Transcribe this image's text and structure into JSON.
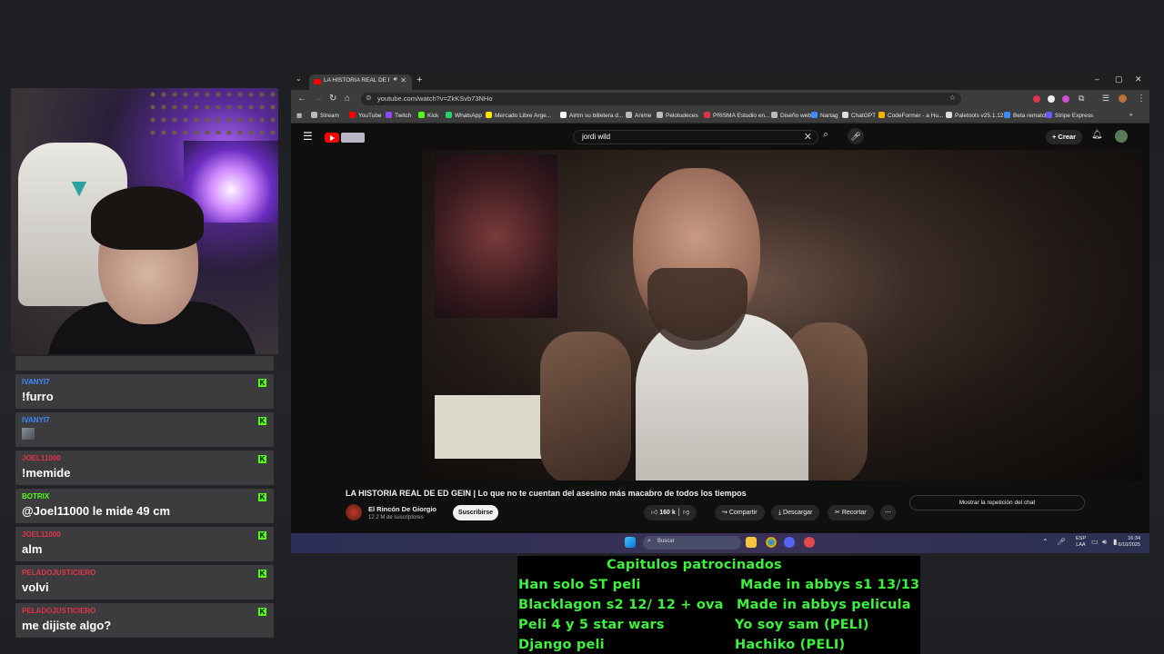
{
  "chat": {
    "messages": [
      {
        "user": "IVANYI7",
        "text": "!furro",
        "user_color": "#3d8bff",
        "emote": false
      },
      {
        "user": "IVANYI7",
        "text": "",
        "user_color": "#3d8bff",
        "emote": true
      },
      {
        "user": "JOEL11000",
        "text": "!memide",
        "user_color": "#e0344a",
        "emote": false
      },
      {
        "user": "BOTRIX",
        "text": "@Joel11000 le mide 49 cm",
        "user_color": "#53fc18",
        "emote": false
      },
      {
        "user": "JOEL11000",
        "text": "alm",
        "user_color": "#e0344a",
        "emote": false
      },
      {
        "user": "PELADOJUSTICIERO",
        "text": "volvi",
        "user_color": "#e0344a",
        "emote": false
      },
      {
        "user": "PELADOJUSTICIERO",
        "text": "me dijiste algo?",
        "user_color": "#e0344a",
        "emote": false
      }
    ]
  },
  "browser": {
    "tab_title": "LA HISTORIA REAL DE ED GEIN",
    "url": "youtube.com/watch?v=ZkKSvb73NHo",
    "bookmarks": [
      {
        "label": "Stream",
        "color": "#bbbbbb"
      },
      {
        "label": "YouTube",
        "color": "#ff0000"
      },
      {
        "label": "Twitch",
        "color": "#9146ff"
      },
      {
        "label": "Kick",
        "color": "#53fc18"
      },
      {
        "label": "WhatsApp",
        "color": "#25d366"
      },
      {
        "label": "Mercado Libre Arge...",
        "color": "#ffe600"
      },
      {
        "label": "Airtm su billetera d...",
        "color": "#ffffff"
      },
      {
        "label": "Anime",
        "color": "#bbbbbb"
      },
      {
        "label": "Pelotudeces",
        "color": "#bbbbbb"
      },
      {
        "label": "PRISMA Estudio en...",
        "color": "#e0344a"
      },
      {
        "label": "Diseño web",
        "color": "#bbbbbb"
      },
      {
        "label": "Nartag",
        "color": "#3d8bff"
      },
      {
        "label": "ChatGPT",
        "color": "#dddddd"
      },
      {
        "label": "CodeFormer - a Hu...",
        "color": "#f5b400"
      },
      {
        "label": "Paletools v25.1.12",
        "color": "#dddddd"
      },
      {
        "label": "Beta rematch",
        "color": "#3d8bff"
      },
      {
        "label": "Stripe Express",
        "color": "#635bff"
      }
    ]
  },
  "youtube": {
    "search_query": "jordi wild",
    "create_label": "Crear",
    "video_title": "LA HISTORIA REAL DE ED GEIN | Lo que no te cuentan del asesino más macabro de todos los tiempos",
    "channel_name": "El Rincón De Giorgio",
    "subscribers": "12.2 M de suscriptores",
    "subscribe_label": "Suscribirse",
    "likes": "160 k",
    "share_label": "Compartir",
    "download_label": "Descargar",
    "clip_label": "Recortar",
    "chat_replay_label": "Mostrar la repetición del chat"
  },
  "taskbar": {
    "search_placeholder": "Buscar",
    "lang_top": "ESP",
    "lang_bottom": "LAA",
    "time": "16:34",
    "date": "6/10/2025"
  },
  "overlay": {
    "title": "Capitulos patrocinados",
    "left": [
      "Han solo ST peli",
      "Blacklagon s2 12/ 12 + ova",
      "Peli 4  y 5 star wars",
      "Django peli"
    ],
    "right": [
      "Made in abbys s1 13/13",
      "Made in abbys pelicula",
      "Yo soy sam (PELI)",
      "Hachiko (PELI)"
    ]
  }
}
